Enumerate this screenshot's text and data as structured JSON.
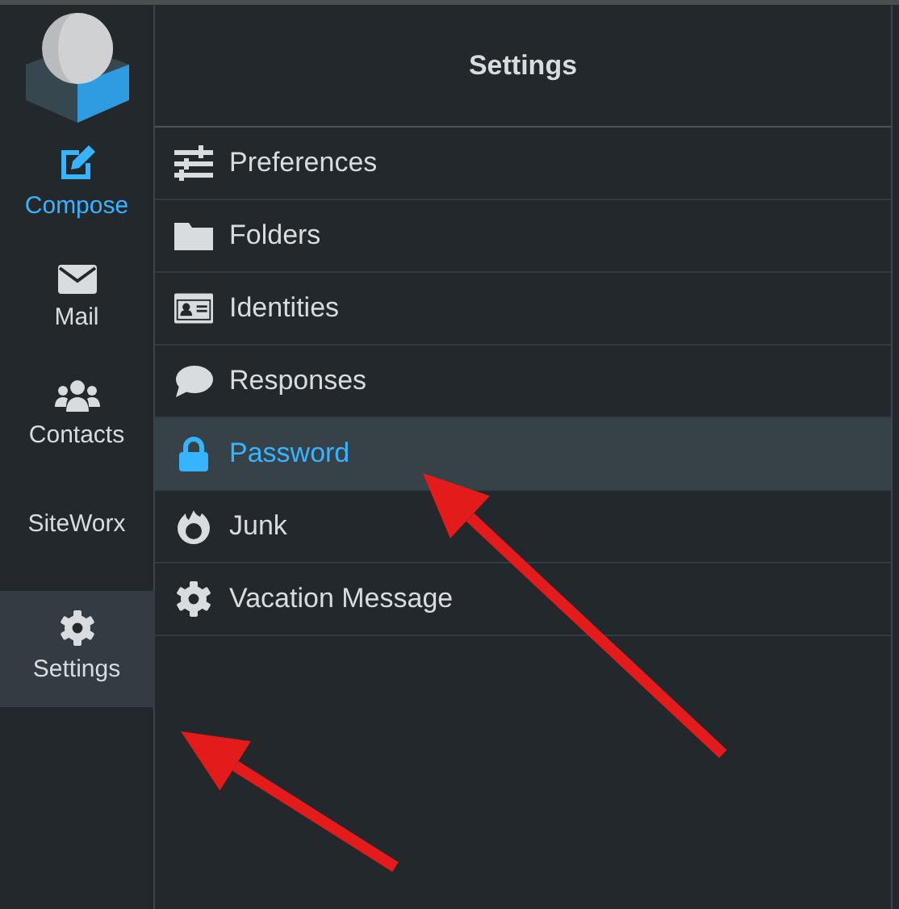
{
  "sidebar": {
    "items": [
      {
        "label": "Compose",
        "kind": "action",
        "selected": false
      },
      {
        "label": "Mail",
        "kind": "nav",
        "selected": false
      },
      {
        "label": "Contacts",
        "kind": "nav",
        "selected": false
      },
      {
        "label": "SiteWorx",
        "kind": "text",
        "selected": false
      },
      {
        "label": "Settings",
        "kind": "nav",
        "selected": true
      }
    ]
  },
  "header": {
    "title": "Settings"
  },
  "menu": [
    {
      "label": "Preferences",
      "selected": false
    },
    {
      "label": "Folders",
      "selected": false
    },
    {
      "label": "Identities",
      "selected": false
    },
    {
      "label": "Responses",
      "selected": false
    },
    {
      "label": "Password",
      "selected": true
    },
    {
      "label": "Junk",
      "selected": false
    },
    {
      "label": "Vacation Message",
      "selected": false
    }
  ],
  "annotations": [
    {
      "kind": "arrow"
    },
    {
      "kind": "arrow"
    }
  ]
}
